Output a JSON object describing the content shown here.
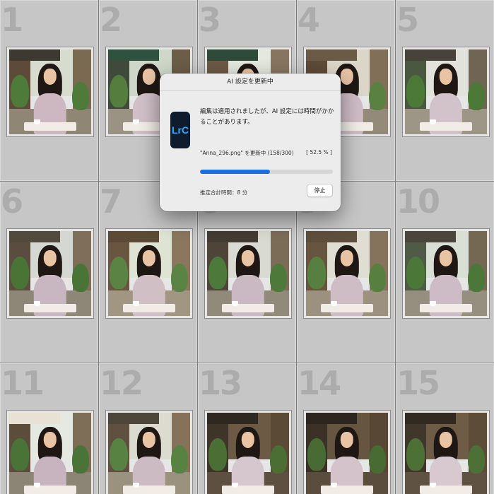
{
  "grid": {
    "cells": [
      {
        "index": "1"
      },
      {
        "index": "2"
      },
      {
        "index": "3"
      },
      {
        "index": "4"
      },
      {
        "index": "5"
      },
      {
        "index": "6"
      },
      {
        "index": "7"
      },
      {
        "index": "8"
      },
      {
        "index": "9"
      },
      {
        "index": "10"
      },
      {
        "index": "11"
      },
      {
        "index": "12"
      },
      {
        "index": "13"
      },
      {
        "index": "14"
      },
      {
        "index": "15"
      }
    ]
  },
  "dialog": {
    "title": "AI 設定を更新中",
    "app_icon": "LrC",
    "message": "編集は適用されましたが、AI 設定には時間がかかることがあります。",
    "status_text": "\"Anna_296.png\" を更新中 (158/300)",
    "percent_text": "[ 52.5 % ]",
    "progress": 0.525,
    "eta_text": "推定合計時間：8 分",
    "stop_label": "停止"
  },
  "colors": {
    "cell_background": "#c6c6c6",
    "index_number": "#acacac",
    "progress_fill": "#1a6fe2",
    "app_icon_bg": "#0e1c2e",
    "app_icon_text": "#33a8f6"
  }
}
